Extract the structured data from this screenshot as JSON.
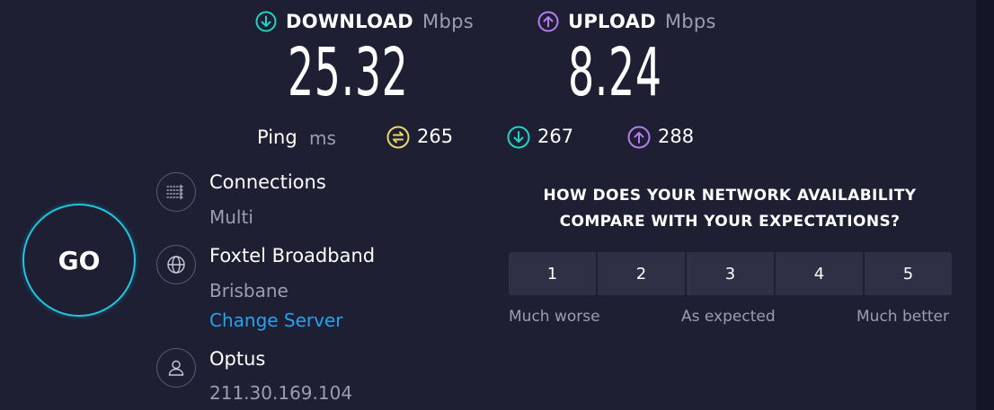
{
  "download": {
    "label": "DOWNLOAD",
    "unit": "Mbps",
    "value": "25.32",
    "icon": "download-arrow-icon",
    "color": "#1fd3c6"
  },
  "upload": {
    "label": "UPLOAD",
    "unit": "Mbps",
    "value": "8.24",
    "icon": "upload-arrow-icon",
    "color": "#b57bf0"
  },
  "ping": {
    "label": "Ping",
    "unit": "ms",
    "idle": {
      "value": "265",
      "icon": "ping-idle-icon",
      "color": "#e8d86a"
    },
    "download": {
      "value": "267",
      "icon": "download-arrow-icon",
      "color": "#1fd3c6"
    },
    "upload": {
      "value": "288",
      "icon": "upload-arrow-icon",
      "color": "#b57bf0"
    }
  },
  "go_button": {
    "label": "GO",
    "color": "#1fc6de"
  },
  "connections": {
    "title": "Connections",
    "value": "Multi",
    "icon": "connections-icon"
  },
  "server": {
    "title": "Foxtel Broadband",
    "location": "Brisbane",
    "change_label": "Change Server",
    "icon": "globe-icon"
  },
  "provider": {
    "title": "Optus",
    "ip": "211.30.169.104",
    "icon": "user-icon"
  },
  "survey": {
    "question_line1": "HOW DOES YOUR NETWORK AVAILABILITY",
    "question_line2": "COMPARE WITH YOUR EXPECTATIONS?",
    "options": [
      "1",
      "2",
      "3",
      "4",
      "5"
    ],
    "low_label": "Much worse",
    "mid_label": "As expected",
    "high_label": "Much better"
  }
}
